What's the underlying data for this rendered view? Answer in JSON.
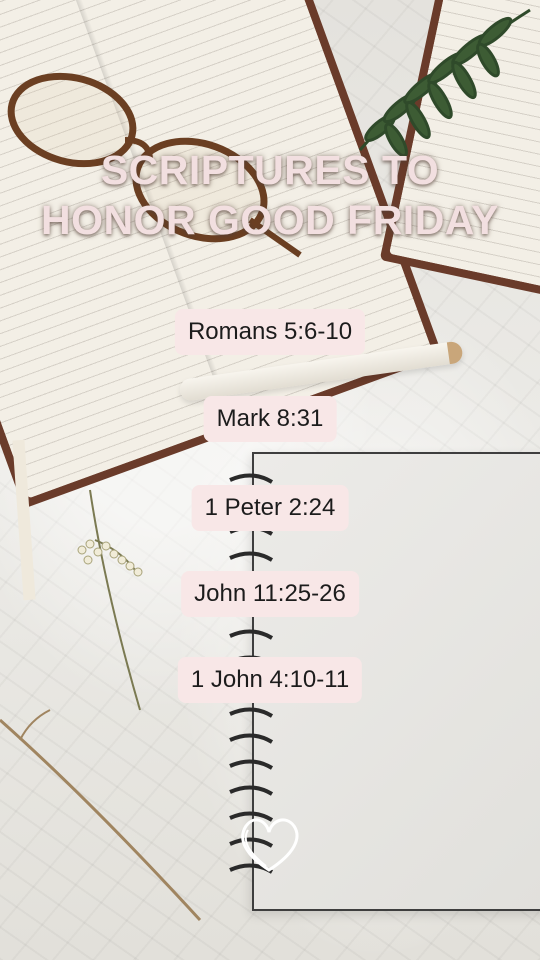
{
  "title": {
    "line1": "SCRIPTURES TO",
    "line2": "HONOR GOOD FRIDAY"
  },
  "scriptures": [
    "Romans 5:6-10",
    "Mark 8:31",
    "1 Peter 2:24",
    "John 11:25-26",
    "1 John 4:10-11"
  ],
  "colors": {
    "title_text": "#f2dfe0",
    "pill_background": "#f8e7e7",
    "pill_text": "#1c1c1c"
  },
  "icons": [
    "glasses-icon",
    "fern-icon",
    "flower-icon",
    "heart-icon",
    "pen-icon"
  ]
}
